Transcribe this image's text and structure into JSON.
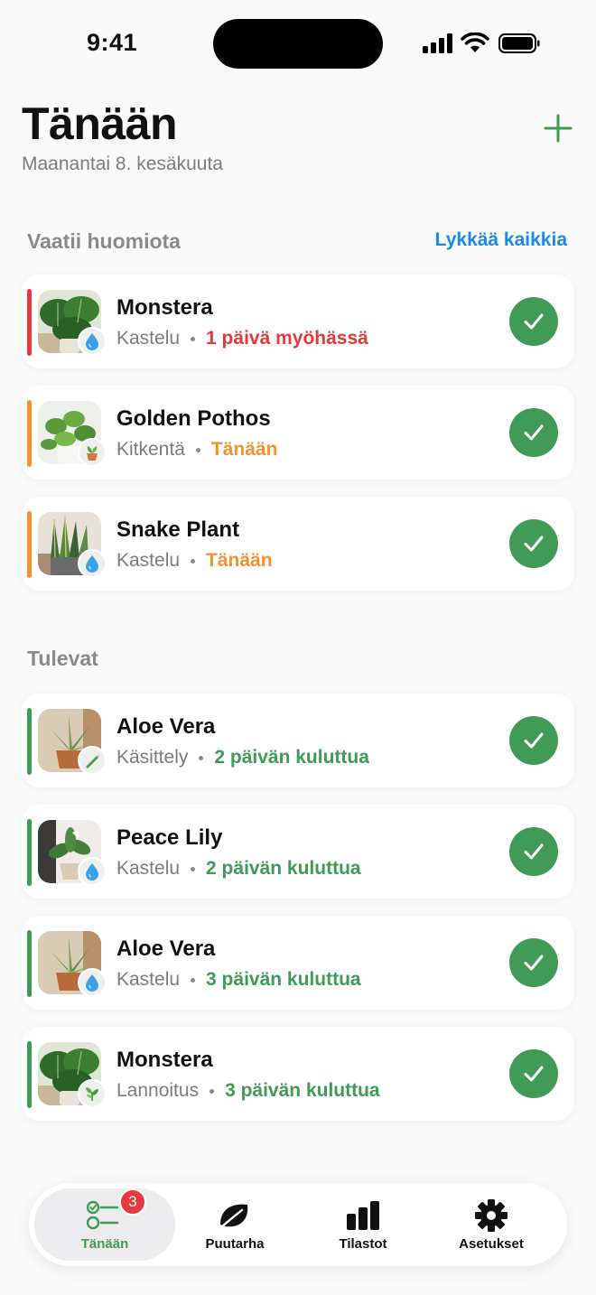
{
  "status_bar": {
    "time": "9:41"
  },
  "header": {
    "title": "Tänään",
    "date": "Maanantai 8. kesäkuuta",
    "add_icon": "plus-icon"
  },
  "colors": {
    "accent": "#3f9b55",
    "link": "#1c8ae6",
    "overdue": "#e5393d",
    "today": "#f5922f",
    "upcoming": "#3f9b55"
  },
  "attention": {
    "title": "Vaatii huomiota",
    "action": "Lykkää kaikkia",
    "items": [
      {
        "plant": "Monstera",
        "task": "Kastelu",
        "task_icon": "water-drop-icon",
        "due": "1 päivä myöhässä",
        "status": "overdue"
      },
      {
        "plant": "Golden Pothos",
        "task": "Kitkentä",
        "task_icon": "potted-plant-icon",
        "due": "Tänään",
        "status": "today"
      },
      {
        "plant": "Snake Plant",
        "task": "Kastelu",
        "task_icon": "water-drop-icon",
        "due": "Tänään",
        "status": "today"
      }
    ]
  },
  "upcoming": {
    "title": "Tulevat",
    "items": [
      {
        "plant": "Aloe Vera",
        "task": "Käsittely",
        "task_icon": "spray-icon",
        "due": "2 päivän kuluttua",
        "status": "upcoming"
      },
      {
        "plant": "Peace Lily",
        "task": "Kastelu",
        "task_icon": "water-drop-icon",
        "due": "2 päivän kuluttua",
        "status": "upcoming"
      },
      {
        "plant": "Aloe Vera",
        "task": "Kastelu",
        "task_icon": "water-drop-icon",
        "due": "3 päivän kuluttua",
        "status": "upcoming"
      },
      {
        "plant": "Monstera",
        "task": "Lannoitus",
        "task_icon": "leaf-sprout-icon",
        "due": "3 päivän kuluttua",
        "status": "upcoming"
      }
    ]
  },
  "tab_bar": {
    "tabs": [
      {
        "label": "Tänään",
        "icon": "checklist-icon",
        "badge": "3",
        "active": true
      },
      {
        "label": "Puutarha",
        "icon": "leaf-icon",
        "active": false
      },
      {
        "label": "Tilastot",
        "icon": "bar-chart-icon",
        "active": false
      },
      {
        "label": "Asetukset",
        "icon": "gear-icon",
        "active": false
      }
    ]
  }
}
